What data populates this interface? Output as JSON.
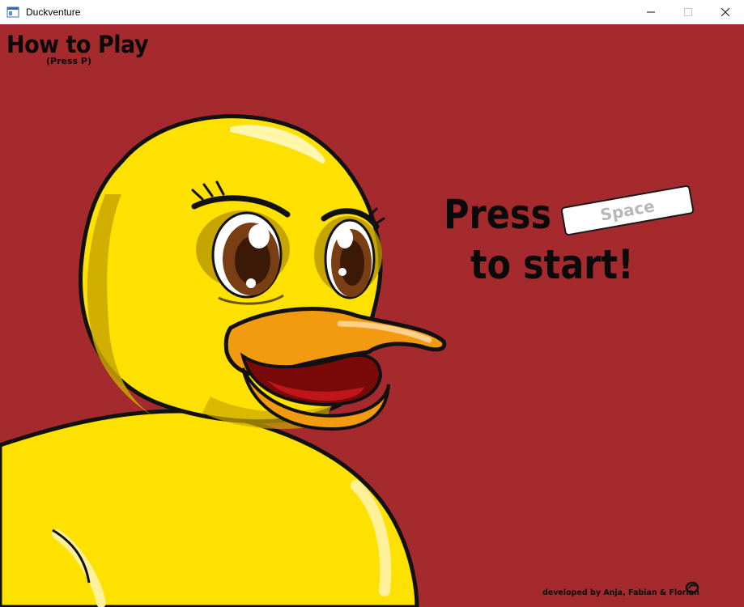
{
  "window": {
    "title": "Duckventure",
    "controls": [
      "minimize-icon",
      "maximize-icon",
      "close-icon"
    ]
  },
  "game": {
    "background_color": "#a42a2d",
    "how_to_play": "How to Play",
    "how_to_play_hint": "(Press P)",
    "press_line1": "Press",
    "press_line2": "to start!",
    "key_label": "Space",
    "credits": "developed by Anja, Fabian & Florian",
    "mascot": "duck-illustration"
  }
}
